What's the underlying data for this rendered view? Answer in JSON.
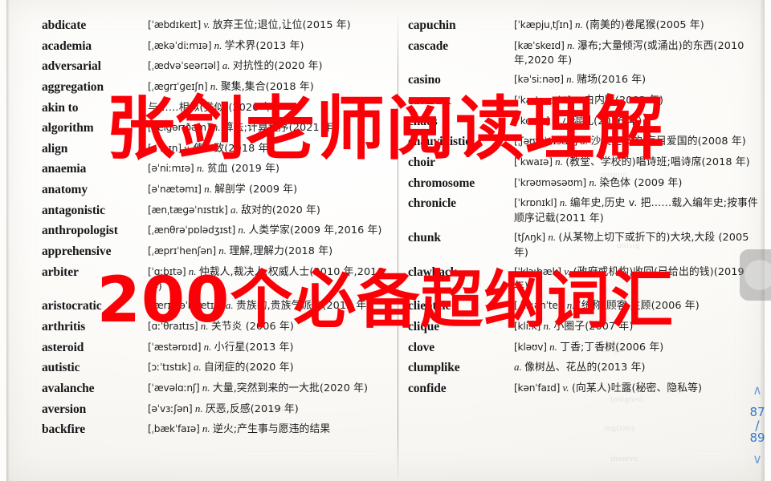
{
  "document": {
    "kind": "scanned-dictionary-page",
    "columns": [
      {
        "id": "left",
        "entries": [
          {
            "headword": "abdicate",
            "ipa": "[ˈæbdɪkeɪt]",
            "pos": "v.",
            "cn": "放弃王位;退位,让位(2015 年)"
          },
          {
            "headword": "academia",
            "ipa": "[ˌækəˈdiːmɪə]",
            "pos": "n.",
            "cn": "学术界(2013 年)"
          },
          {
            "headword": "adversarial",
            "ipa": "[ˌædvəˈseərɪəl]",
            "pos": "a.",
            "cn": "对抗性的(2020 年)"
          },
          {
            "headword": "aggregation",
            "ipa": "[ˌæɡrɪˈɡeɪʃn]",
            "pos": "n.",
            "cn": "聚集,集合(2018 年)"
          },
          {
            "headword": "akin to",
            "ipa": "",
            "pos": "",
            "cn": "与……相似(类似)(2020 年)"
          },
          {
            "headword": "algorithm",
            "ipa": "[ˈælɡərɪðəm]",
            "pos": "n.",
            "cn": "算法;计算程序(2021 年)"
          },
          {
            "headword": "align",
            "ipa": "[əˈlaɪn]",
            "pos": "v.",
            "cn": "使一致(2018 年)"
          },
          {
            "headword": "anaemia",
            "ipa": "[əˈniːmɪə]",
            "pos": "n.",
            "cn": "贫血 (2019 年)"
          },
          {
            "headword": "anatomy",
            "ipa": "[əˈnætəmɪ]",
            "pos": "n.",
            "cn": "解剖学 (2009 年)"
          },
          {
            "headword": "antagonistic",
            "ipa": "[ænˌtæɡəˈnɪstɪk]",
            "pos": "a.",
            "cn": "敌对的(2020 年)"
          },
          {
            "headword": "anthropologist",
            "ipa": "[ˌænθrəˈpɒlədʒɪst]",
            "pos": "n.",
            "cn": "人类学家(2009 年,2016 年)"
          },
          {
            "headword": "apprehensive",
            "ipa": "[ˌæprɪˈhenʃən]",
            "pos": "n.",
            "cn": "理解,理解力(2018 年)"
          },
          {
            "headword": "arbiter",
            "ipa": "[ˈɑːbɪtə]",
            "pos": "n.",
            "cn": "仲裁人,裁决人;权威人士(2010 年,2016 年)"
          },
          {
            "headword": "aristocratic",
            "ipa": "[ˌærɪstəˈkrætɪk]",
            "pos": "a.",
            "cn": "贵族的,贵族气派的(2015 年)"
          },
          {
            "headword": "arthritis",
            "ipa": "[ɑːˈθraɪtɪs]",
            "pos": "n.",
            "cn": "关节炎 (2006 年)"
          },
          {
            "headword": "asteroid",
            "ipa": "[ˈæstərɒɪd]",
            "pos": "n.",
            "cn": "小行星(2013 年)"
          },
          {
            "headword": "autistic",
            "ipa": "[ɔːˈtɪstɪk]",
            "pos": "a.",
            "cn": "自闭症的(2020 年)"
          },
          {
            "headword": "avalanche",
            "ipa": "[ˈævəlɑːnʃ]",
            "pos": "n.",
            "cn": "大量,突然到来的一大批(2020 年)"
          },
          {
            "headword": "aversion",
            "ipa": "[əˈvɜːʃən]",
            "pos": "n.",
            "cn": "厌恶,反感(2019 年)"
          },
          {
            "headword": "backfire",
            "ipa": "[ˌbækˈfaɪə]",
            "pos": "n.",
            "cn": "逆火;产生事与愿违的结果"
          }
        ]
      },
      {
        "id": "right",
        "entries": [
          {
            "headword": "capuchin",
            "ipa": "[ˈkæpjuˌtʃɪn]",
            "pos": "n.",
            "cn": "(南美的)卷尾猴(2005 年)"
          },
          {
            "headword": "cascade",
            "ipa": "[kæˈskeɪd]",
            "pos": "n.",
            "cn": "瀑布;大量倾泻(或涌出)的东西(2010 年,2020 年)"
          },
          {
            "headword": "casino",
            "ipa": "[kəˈsiːnəʊ]",
            "pos": "n.",
            "cn": "赌场(2016 年)"
          },
          {
            "headword": "cataract",
            "ipa": "[ˈkætərækt]",
            "pos": "n.",
            "cn": "白内障(2003 年)"
          },
          {
            "headword": "chaos",
            "ipa": "[ˈkeɪɒs]",
            "pos": "n.",
            "cn": "小混乱(2016 年)"
          },
          {
            "headword": "chauvinistic",
            "ipa": "[ˌʃəʊvɪˈnɪstɪk]",
            "pos": "a.",
            "cn": "沙文主义的,盲目爱国的(2008 年)"
          },
          {
            "headword": "choir",
            "ipa": "[ˈkwaɪə]",
            "pos": "n.",
            "cn": "(教堂、学校的)唱诗班;唱诗席(2018 年)"
          },
          {
            "headword": "chromosome",
            "ipa": "[ˈkrəʊməsəʊm]",
            "pos": "n.",
            "cn": "染色体 (2009 年)"
          },
          {
            "headword": "chronicle",
            "ipa": "[ˈkrɒnɪkl]",
            "pos": "n.",
            "cn": "编年史,历史 v. 把……载入编年史;按事件顺序记载(2011 年)"
          },
          {
            "headword": "chunk",
            "ipa": "[tʃʌŋk]",
            "pos": "n.",
            "cn": "(从某物上切下或折下的)大块,大段 (2005 年)"
          },
          {
            "headword": "clawback",
            "ipa": "[ˈklɔːbæk]",
            "pos": "v.",
            "cn": "(政府或机构)收回(已给出的钱)(2019 年)"
          },
          {
            "headword": "clientele",
            "ipa": "[ˌkliːənˈtel]",
            "pos": "n.",
            "cn": "(统称)顾客,主顾(2006 年)"
          },
          {
            "headword": "clique",
            "ipa": "[kliːk]",
            "pos": "n.",
            "cn": "小圈子(2007 年)"
          },
          {
            "headword": "clove",
            "ipa": "[kləʊv]",
            "pos": "n.",
            "cn": "丁香;丁香树(2006 年)"
          },
          {
            "headword": "clumplike",
            "ipa": "",
            "pos": "a.",
            "cn": "像树丛、花丛的(2013 年)"
          },
          {
            "headword": "confide",
            "ipa": "[kənˈfaɪd]",
            "pos": "v.",
            "cn": "(向某人)吐露(秘密、隐私等)"
          }
        ]
      }
    ]
  },
  "promo": {
    "line1": "张剑老师阅读理解",
    "line2": "200个必备超纲词汇",
    "color": "#fb0007"
  },
  "page_nav": {
    "up_icon": "chevron-up",
    "current_page": "87",
    "separator": "/",
    "total_pages": "89",
    "down_icon": "chevron-down",
    "color": "#2f7ad0"
  },
  "float_control": {
    "label": "",
    "color": "#808080"
  }
}
